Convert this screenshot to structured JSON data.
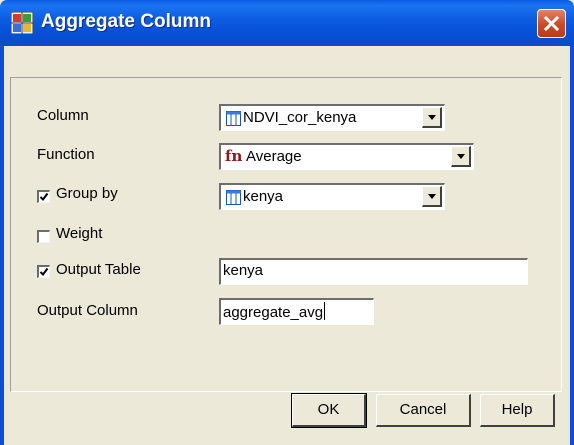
{
  "window": {
    "title": "Aggregate Column",
    "app_icon": "map-grid-icon",
    "close_icon": "close-icon"
  },
  "form": {
    "column": {
      "label": "Column",
      "value": "NDVI_cor_kenya",
      "icon": "table-icon"
    },
    "function": {
      "label": "Function",
      "value": "Average",
      "icon": "fn-icon",
      "icon_text": "fn"
    },
    "group_by": {
      "label": "Group by",
      "checked": true,
      "value": "kenya",
      "icon": "table-icon"
    },
    "weight": {
      "label": "Weight",
      "checked": false
    },
    "output_table": {
      "label": "Output Table",
      "checked": true,
      "value": "kenya"
    },
    "output_column": {
      "label": "Output Column",
      "value": "aggregate_avg"
    }
  },
  "buttons": {
    "ok": "OK",
    "cancel": "Cancel",
    "help": "Help"
  },
  "colors": {
    "titlebar": "#0a5ce3",
    "close_button": "#c94a25",
    "dialog_face": "#ece9d8",
    "fn_icon": "#8b1a1a"
  }
}
